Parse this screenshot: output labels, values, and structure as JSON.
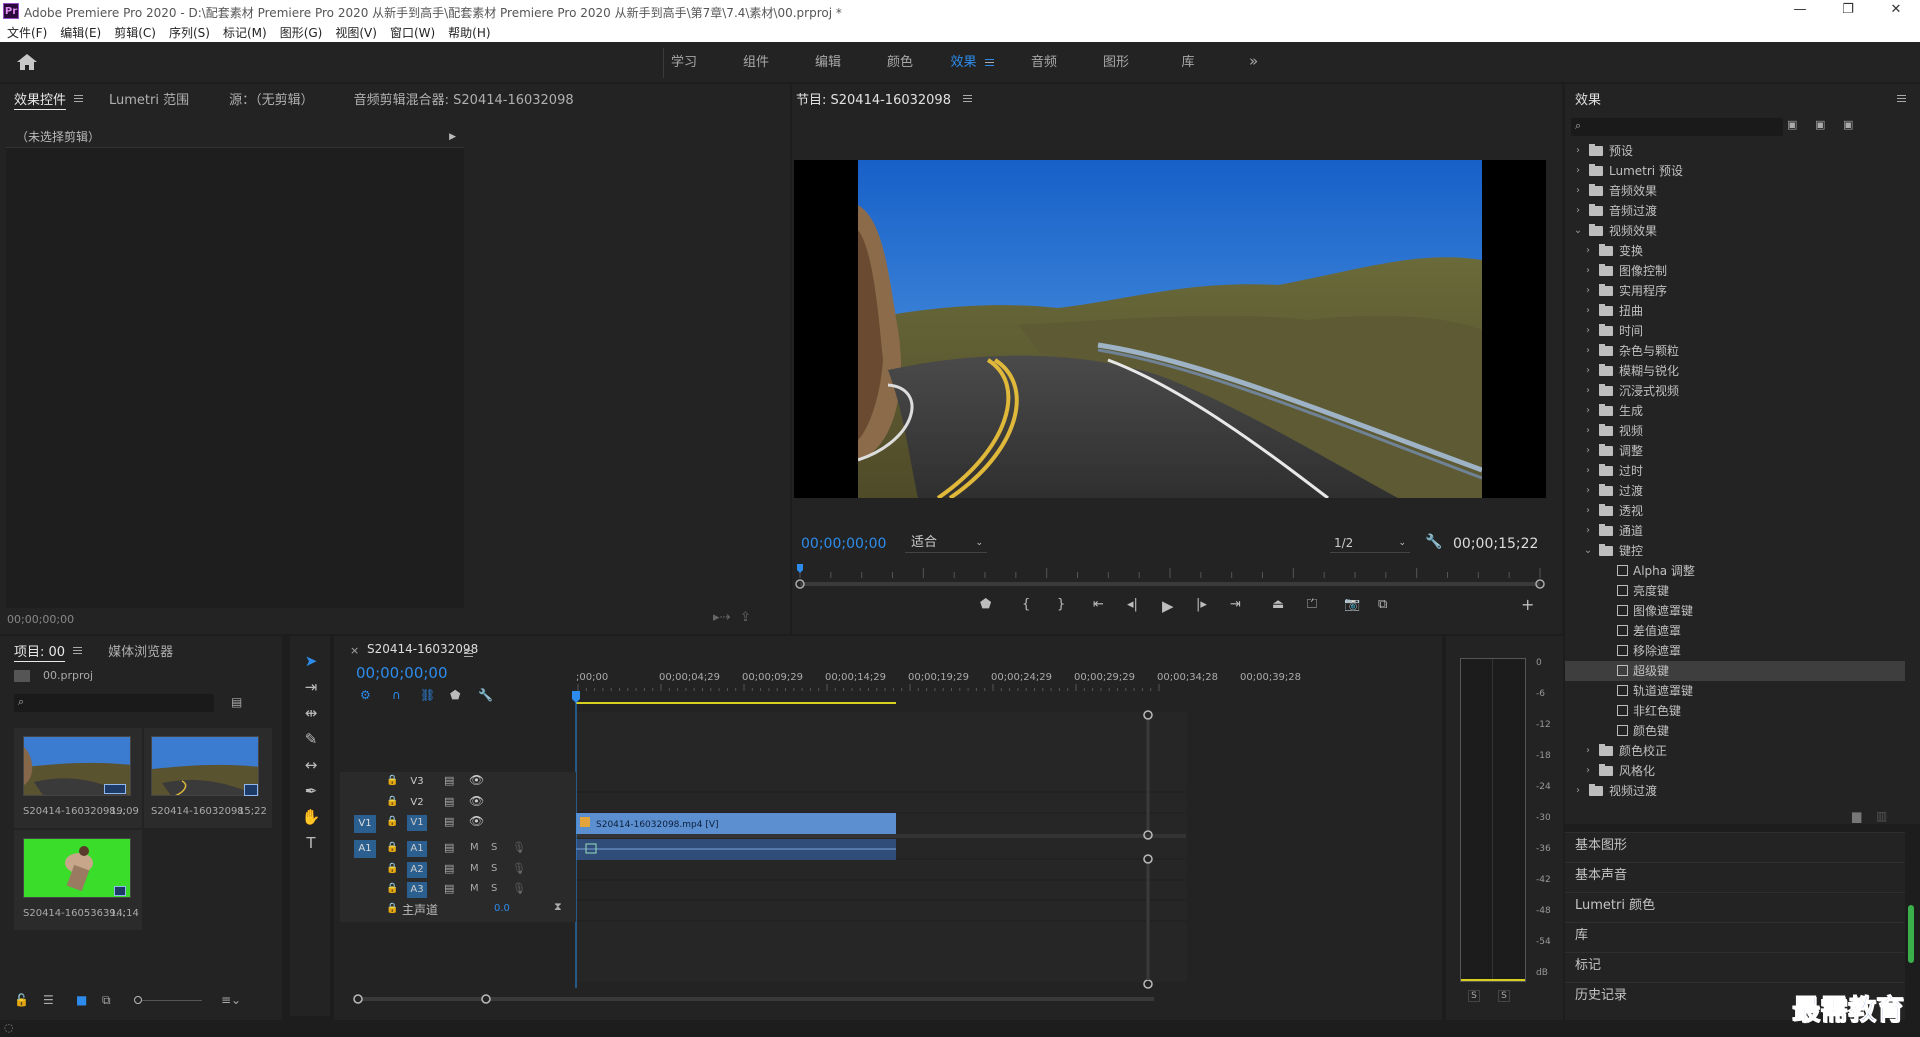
{
  "window": {
    "app_icon": "Pr",
    "title": "Adobe Premiere Pro 2020 - D:\\配套素材 Premiere Pro 2020 从新手到高手\\配套素材 Premiere Pro 2020 从新手到高手\\第7章\\7.4\\素材\\00.prproj *",
    "minimize": "—",
    "maximize": "❐",
    "close": "✕"
  },
  "menu": [
    "文件(F)",
    "编辑(E)",
    "剪辑(C)",
    "序列(S)",
    "标记(M)",
    "图形(G)",
    "视图(V)",
    "窗口(W)",
    "帮助(H)"
  ],
  "workspaces": {
    "tabs": [
      "学习",
      "组件",
      "编辑",
      "颜色",
      "效果",
      "音频",
      "图形",
      "库"
    ],
    "active": "效果",
    "more": "»"
  },
  "effect_controls": {
    "tabs": [
      "效果控件",
      "Lumetri 范围",
      "源：（无剪辑）",
      "音频剪辑混合器: S20414-16032098"
    ],
    "no_clip": "（未选择剪辑）",
    "timecode": "00;00;00;00"
  },
  "program": {
    "title": "节目: S20414-16032098",
    "timecode_current": "00;00;00;00",
    "fit": "适合",
    "resolution": "1/2",
    "timecode_duration": "00;00;15;22",
    "playhead_fraction": 0.0
  },
  "effects_panel": {
    "title": "效果",
    "tree": [
      {
        "label": "预设",
        "level": 0,
        "kind": "folder",
        "expanded": false
      },
      {
        "label": "Lumetri 预设",
        "level": 0,
        "kind": "folder",
        "expanded": false
      },
      {
        "label": "音频效果",
        "level": 0,
        "kind": "folder",
        "expanded": false
      },
      {
        "label": "音频过渡",
        "level": 0,
        "kind": "folder",
        "expanded": false
      },
      {
        "label": "视频效果",
        "level": 0,
        "kind": "folder",
        "expanded": true
      },
      {
        "label": "变换",
        "level": 1,
        "kind": "folder",
        "expanded": false
      },
      {
        "label": "图像控制",
        "level": 1,
        "kind": "folder",
        "expanded": false
      },
      {
        "label": "实用程序",
        "level": 1,
        "kind": "folder",
        "expanded": false
      },
      {
        "label": "扭曲",
        "level": 1,
        "kind": "folder",
        "expanded": false
      },
      {
        "label": "时间",
        "level": 1,
        "kind": "folder",
        "expanded": false
      },
      {
        "label": "杂色与颗粒",
        "level": 1,
        "kind": "folder",
        "expanded": false
      },
      {
        "label": "模糊与锐化",
        "level": 1,
        "kind": "folder",
        "expanded": false
      },
      {
        "label": "沉浸式视频",
        "level": 1,
        "kind": "folder",
        "expanded": false
      },
      {
        "label": "生成",
        "level": 1,
        "kind": "folder",
        "expanded": false
      },
      {
        "label": "视频",
        "level": 1,
        "kind": "folder",
        "expanded": false
      },
      {
        "label": "调整",
        "level": 1,
        "kind": "folder",
        "expanded": false
      },
      {
        "label": "过时",
        "level": 1,
        "kind": "folder",
        "expanded": false
      },
      {
        "label": "过渡",
        "level": 1,
        "kind": "folder",
        "expanded": false
      },
      {
        "label": "透视",
        "level": 1,
        "kind": "folder",
        "expanded": false
      },
      {
        "label": "通道",
        "level": 1,
        "kind": "folder",
        "expanded": false
      },
      {
        "label": "键控",
        "level": 1,
        "kind": "folder",
        "expanded": true
      },
      {
        "label": "Alpha 调整",
        "level": 2,
        "kind": "effect"
      },
      {
        "label": "亮度键",
        "level": 2,
        "kind": "effect"
      },
      {
        "label": "图像遮罩键",
        "level": 2,
        "kind": "effect"
      },
      {
        "label": "差值遮罩",
        "level": 2,
        "kind": "effect"
      },
      {
        "label": "移除遮罩",
        "level": 2,
        "kind": "effect"
      },
      {
        "label": "超级键",
        "level": 2,
        "kind": "effect",
        "selected": true
      },
      {
        "label": "轨道遮罩键",
        "level": 2,
        "kind": "effect"
      },
      {
        "label": "非红色键",
        "level": 2,
        "kind": "effect"
      },
      {
        "label": "颜色键",
        "level": 2,
        "kind": "effect"
      },
      {
        "label": "颜色校正",
        "level": 1,
        "kind": "folder",
        "expanded": false
      },
      {
        "label": "风格化",
        "level": 1,
        "kind": "folder",
        "expanded": false
      },
      {
        "label": "视频过渡",
        "level": 0,
        "kind": "folder",
        "expanded": false
      }
    ],
    "sections": [
      "基本图形",
      "基本声音",
      "Lumetri 颜色",
      "库",
      "标记",
      "历史记录"
    ]
  },
  "project": {
    "tabs": [
      "项目: 00",
      "媒体浏览器"
    ],
    "file": "00.prproj",
    "items": [
      {
        "name": "S20414-16032098...",
        "duration": "19;09"
      },
      {
        "name": "S20414-16032098",
        "duration": "15;22"
      },
      {
        "name": "S20414-16053639...",
        "duration": "14;14"
      }
    ]
  },
  "timeline": {
    "sequence": "S20414-16032098",
    "timecode": "00;00;00;00",
    "ruler": [
      ";00;00",
      "00;00;04;29",
      "00;00;09;29",
      "00;00;14;29",
      "00;00;19;29",
      "00;00;24;29",
      "00;00;29;29",
      "00;00;34;28",
      "00;00;39;28"
    ],
    "video_tracks": [
      "V3",
      "V2",
      "V1"
    ],
    "audio_tracks": [
      "A1",
      "A2",
      "A3"
    ],
    "source_v": "V1",
    "source_a": "A1",
    "master_label": "主声道",
    "master_value": "0.0",
    "clip_label": "S20414-16032098.mp4 [V]",
    "track_buttons": {
      "mute": "M",
      "solo": "S"
    }
  },
  "meter": {
    "scale": [
      "0",
      "-6",
      "-12",
      "-18",
      "-24",
      "-30",
      "-36",
      "-42",
      "-48",
      "-54",
      "dB"
    ],
    "solo_left": "S",
    "solo_right": "S"
  },
  "watermark": "最需教育",
  "colors": {
    "accent": "#2d8ceb",
    "clip": "#5c8fcf",
    "workarea": "#d7d01f"
  }
}
